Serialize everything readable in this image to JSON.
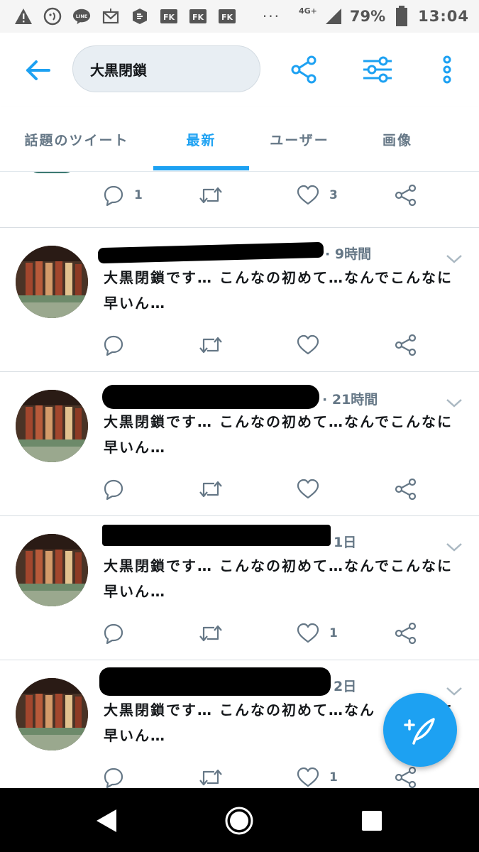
{
  "status_bar": {
    "network_label": "4G+",
    "battery_percent": "79%",
    "time": "13:04",
    "icons": [
      "warning-icon",
      "message-icon",
      "line-app-icon",
      "mail-icon",
      "app-icon",
      "fk-icon",
      "fk-icon",
      "fk-icon"
    ]
  },
  "header": {
    "search_query": "大黒閉鎖",
    "accent_color": "#1da1f2"
  },
  "tabs": [
    {
      "label": "話題のツイート",
      "active": false
    },
    {
      "label": "最新",
      "active": true
    },
    {
      "label": "ユーザー",
      "active": false
    },
    {
      "label": "画像",
      "active": false
    }
  ],
  "tweets": [
    {
      "time": "",
      "text": "",
      "reply_count": "1",
      "like_count": "3"
    },
    {
      "time": "9時間",
      "text": "大黒閉鎖です… こんなの初めて…なんでこんなに 早いん…",
      "reply_count": "",
      "like_count": ""
    },
    {
      "time": "21時間",
      "text": "大黒閉鎖です… こんなの初めて…なんでこんなに 早いん…",
      "reply_count": "",
      "like_count": ""
    },
    {
      "time": "1日",
      "text": "大黒閉鎖です… こんなの初めて…なんでこんなに 早いん…",
      "reply_count": "",
      "like_count": "1"
    },
    {
      "time": "2日",
      "text": "大黒閉鎖です… こんなの初めて…なん　　　　に 早いん…",
      "reply_count": "",
      "like_count": "1"
    }
  ]
}
